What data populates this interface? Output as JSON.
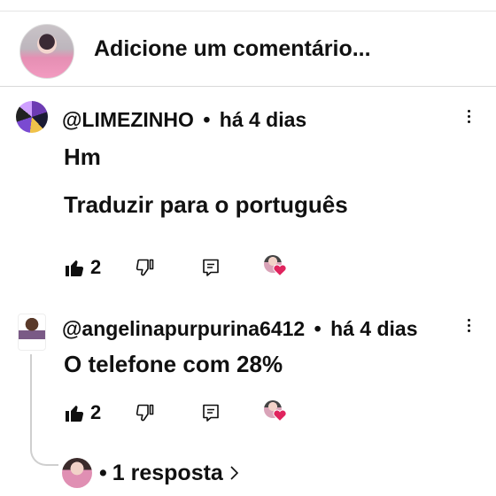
{
  "composer": {
    "placeholder": "Adicione um comentário..."
  },
  "comments": [
    {
      "author": "@LIMEZINHO",
      "separator": "•",
      "time": "há 4 dias",
      "text": "Hm",
      "translate_label": "Traduzir para o português",
      "likes": "2",
      "creator_heart": true
    },
    {
      "author": "@angelinapurpurina6412",
      "separator": "•",
      "time": "há 4 dias",
      "text": "O telefone com 28%",
      "likes": "2",
      "creator_heart": true
    }
  ],
  "replies": {
    "separator": "•",
    "label": "1 resposta"
  },
  "colors": {
    "text": "#0f0f0f",
    "divider": "#e5e5e5",
    "heart": "#e0245e"
  },
  "icons": [
    "thumbs-up-icon",
    "thumbs-down-icon",
    "reply-icon",
    "more-vert-icon",
    "heart-icon",
    "chevron-right-icon"
  ]
}
